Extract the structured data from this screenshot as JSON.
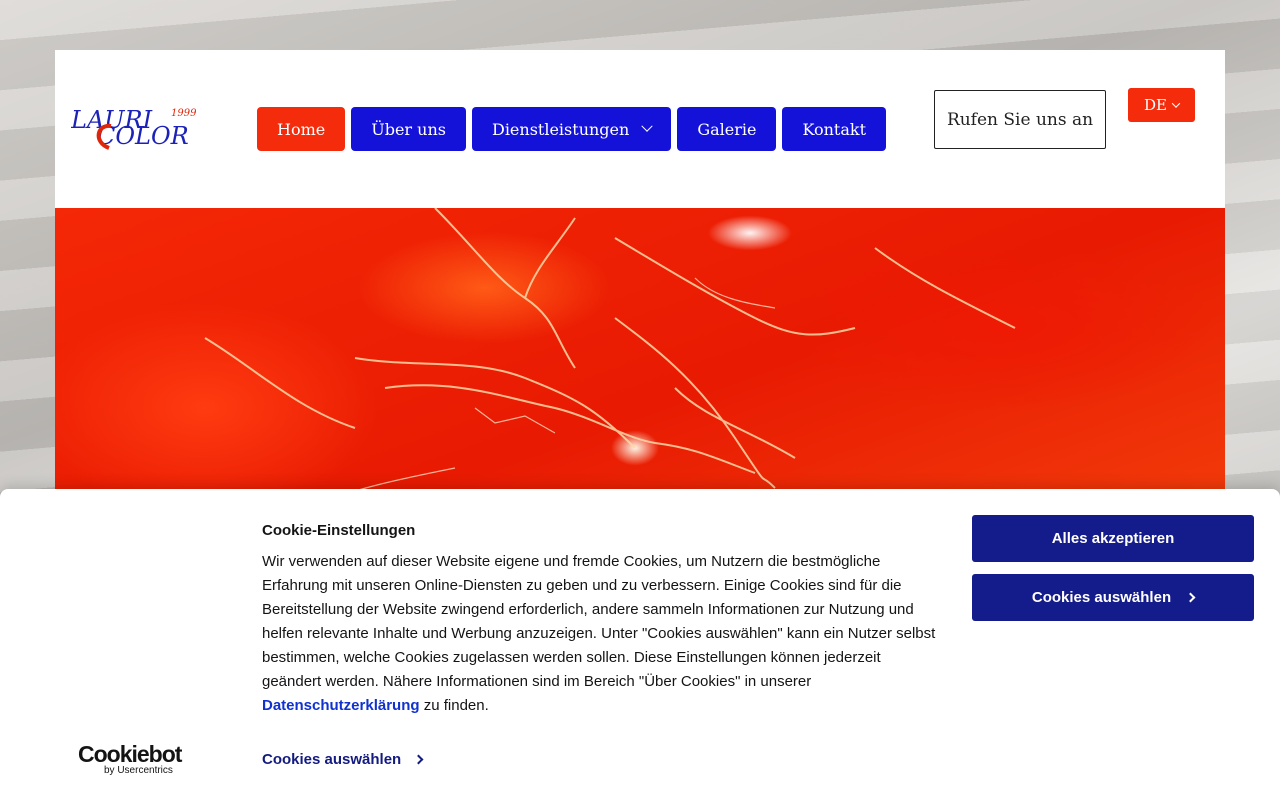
{
  "logo": {
    "line1": "LAURI",
    "line2": "COLOR",
    "year": "1999"
  },
  "nav": {
    "items": [
      {
        "label": "Home"
      },
      {
        "label": "Über uns"
      },
      {
        "label": "Dienstleistungen"
      },
      {
        "label": "Galerie"
      },
      {
        "label": "Kontakt"
      }
    ]
  },
  "header": {
    "call_label": "Rufen Sie uns an",
    "lang_label": "DE"
  },
  "cookie": {
    "title": "Cookie-Einstellungen",
    "text": "Wir verwenden auf dieser Website eigene und fremde Cookies, um Nutzern die bestmögliche Erfahrung mit unseren Online-Diensten zu geben und zu verbessern. Einige Cookies sind für die Bereitstellung der Website zwingend erforderlich, andere sammeln Informationen zur Nutzung und helfen relevante Inhalte und Werbung anzuzeigen. Unter \"Cookies auswählen\" kann ein Nutzer selbst bestimmen, welche Cookies zugelassen werden sollen. Diese Einstellungen können jederzeit geändert werden. Nähere Informationen sind im Bereich \"Über Cookies\" in unserer",
    "privacy_link": "Datenschutzerklärung",
    "text_end": "zu finden.",
    "select_link": "Cookies auswählen",
    "accept_all": "Alles akzeptieren",
    "choose_cookies": "Cookies auswählen",
    "brand": "Cookiebot",
    "brand_sub": "by Usercentrics"
  },
  "colors": {
    "nav_blue": "#1412d8",
    "nav_red": "#f42c0b",
    "cookie_blue": "#141b8a"
  }
}
